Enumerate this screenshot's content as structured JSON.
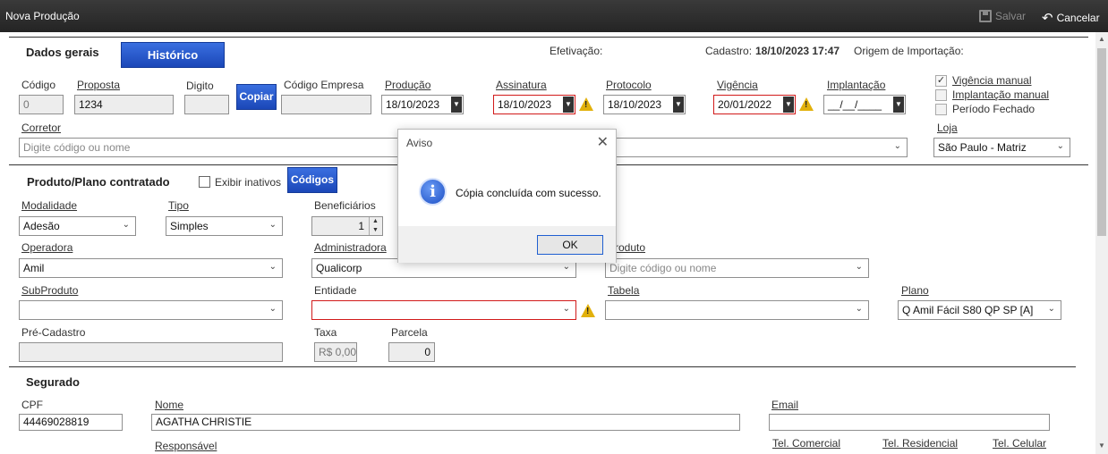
{
  "window": {
    "title": "Nova Produção",
    "save_label": "Salvar",
    "cancel_label": "Cancelar"
  },
  "dados_gerais": {
    "title": "Dados gerais",
    "historico_button": "Histórico",
    "efetivacao_label": "Efetivação:",
    "cadastro_label": "Cadastro:",
    "cadastro_value": "18/10/2023 17:47",
    "origem_label": "Origem de Importação:",
    "codigo_label": "Código",
    "codigo_value": "0",
    "proposta_label": "Proposta",
    "proposta_value": "1234",
    "digito_label": "Digito",
    "digito_value": "",
    "copiar_button": "Copiar",
    "codigo_empresa_label": "Código Empresa",
    "codigo_empresa_value": "",
    "producao_label": "Produção",
    "producao_value": "18/10/2023",
    "assinatura_label": "Assinatura",
    "assinatura_value": "18/10/2023",
    "protocolo_label": "Protocolo",
    "protocolo_value": "18/10/2023",
    "vigencia_label": "Vigência",
    "vigencia_value": "20/01/2022",
    "implantacao_label": "Implantação",
    "implantacao_value": "__/__/____",
    "vigencia_manual": "Vigência manual",
    "implantacao_manual": "Implantação manual",
    "periodo_fechado": "Período Fechado",
    "corretor_label": "Corretor",
    "corretor_placeholder": "Digite código ou nome",
    "loja_label": "Loja",
    "loja_value": "São Paulo - Matriz"
  },
  "produto": {
    "title": "Produto/Plano contratado",
    "exibir_inativos": "Exibir inativos",
    "codigos_button": "Códigos",
    "modalidade_label": "Modalidade",
    "modalidade_value": "Adesão",
    "tipo_label": "Tipo",
    "tipo_value": "Simples",
    "beneficiarios_label": "Beneficiários",
    "beneficiarios_value": "1",
    "operadora_label": "Operadora",
    "operadora_value": "Amil",
    "administradora_label": "Administradora",
    "administradora_value": "Qualicorp",
    "produto_label": "Produto",
    "produto_placeholder": "Digite código ou nome",
    "subproduto_label": "SubProduto",
    "subproduto_value": "",
    "entidade_label": "Entidade",
    "entidade_value": "",
    "tabela_label": "Tabela",
    "tabela_value": "",
    "plano_label": "Plano",
    "plano_value": "Q Amil Fácil S80 QP SP [A]",
    "pre_cadastro_label": "Pré-Cadastro",
    "pre_cadastro_value": "",
    "taxa_label": "Taxa",
    "taxa_value": "R$ 0,00",
    "parcela_label": "Parcela",
    "parcela_value": "0"
  },
  "segurado": {
    "title": "Segurado",
    "cpf_label": "CPF",
    "cpf_value": "44469028819",
    "nome_label": "Nome",
    "nome_value": "AGATHA CHRISTIE",
    "email_label": "Email",
    "email_value": "",
    "responsavel_label": "Responsável",
    "tel_comercial_label": "Tel. Comercial",
    "tel_residencial_label": "Tel. Residencial",
    "tel_celular_label": "Tel. Celular"
  },
  "dialog": {
    "title": "Aviso",
    "message": "Cópia concluída com sucesso.",
    "ok_label": "OK",
    "icon": "info-icon"
  },
  "colors": {
    "titlebar": "#2b2b2b",
    "accent_blue": "#1f4fc4",
    "warning": "#e2b10c",
    "error_border": "#d11a1a"
  }
}
